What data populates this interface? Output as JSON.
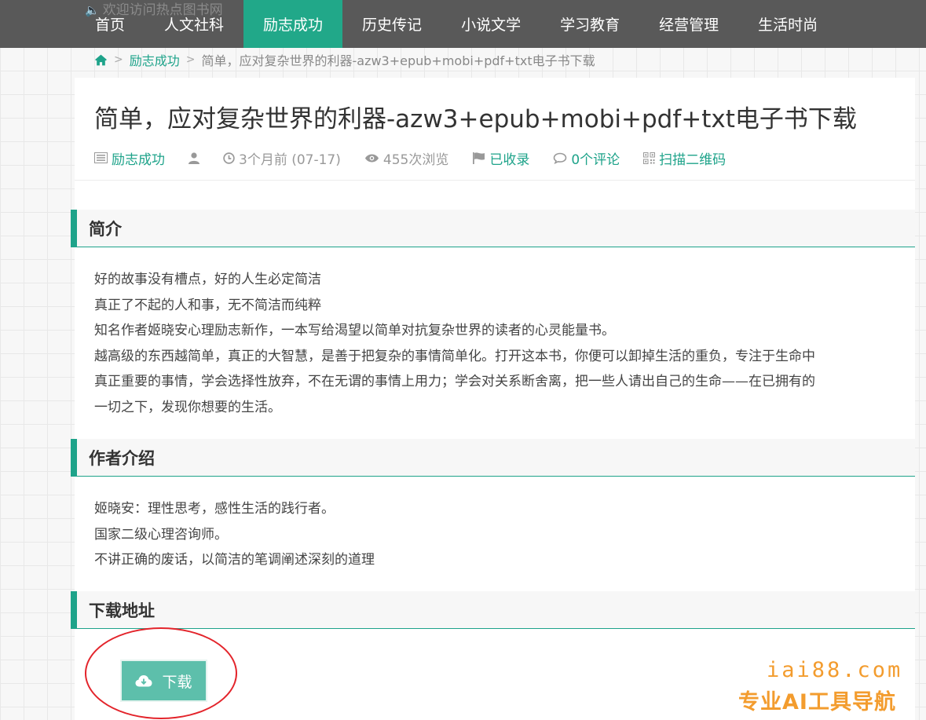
{
  "header": {
    "welcome": "欢迎访问热点图书网",
    "nav": [
      {
        "label": "首页",
        "active": false
      },
      {
        "label": "人文社科",
        "active": false
      },
      {
        "label": "励志成功",
        "active": true
      },
      {
        "label": "历史传记",
        "active": false
      },
      {
        "label": "小说文学",
        "active": false
      },
      {
        "label": "学习教育",
        "active": false
      },
      {
        "label": "经营管理",
        "active": false
      },
      {
        "label": "生活时尚",
        "active": false
      }
    ]
  },
  "breadcrumb": {
    "category": "励志成功",
    "current": "简单，应对复杂世界的利器-azw3+epub+mobi+pdf+txt电子书下载"
  },
  "article": {
    "title": "简单，应对复杂世界的利器-azw3+epub+mobi+pdf+txt电子书下载",
    "meta": {
      "category": "励志成功",
      "time": "3个月前 (07-17)",
      "views": "455次浏览",
      "indexed": "已收录",
      "comments": "0个评论",
      "qrcode": "扫描二维码"
    }
  },
  "sections": {
    "intro": {
      "heading": "简介",
      "lines": [
        "好的故事没有槽点，好的人生必定简洁",
        "真正了不起的人和事，无不简洁而纯粹",
        "知名作者姬晓安心理励志新作，一本写给渴望以简单对抗复杂世界的读者的心灵能量书。",
        "越高级的东西越简单，真正的大智慧，是善于把复杂的事情简单化。打开这本书，你便可以卸掉生活的重负，专注于生命中",
        "真正重要的事情，学会选择性放弃，不在无谓的事情上用力；学会对关系断舍离，把一些人请出自己的生命——在已拥有的",
        "一切之下，发现你想要的生活。"
      ]
    },
    "author": {
      "heading": "作者介绍",
      "lines": [
        "姬晓安：理性思考，感性生活的践行者。",
        "国家二级心理咨询师。",
        "不讲正确的废话，以简洁的笔调阐述深刻的道理"
      ]
    },
    "download": {
      "heading": "下载地址",
      "button_label": "下载"
    }
  },
  "watermark": {
    "url": "iai88.com",
    "tagline": "专业AI工具导航"
  },
  "colors": {
    "accent": "#1ea38a",
    "nav_bg": "#595959",
    "button": "#5dbfab",
    "annotation": "#e3242b",
    "watermark": "#f39c2e"
  }
}
